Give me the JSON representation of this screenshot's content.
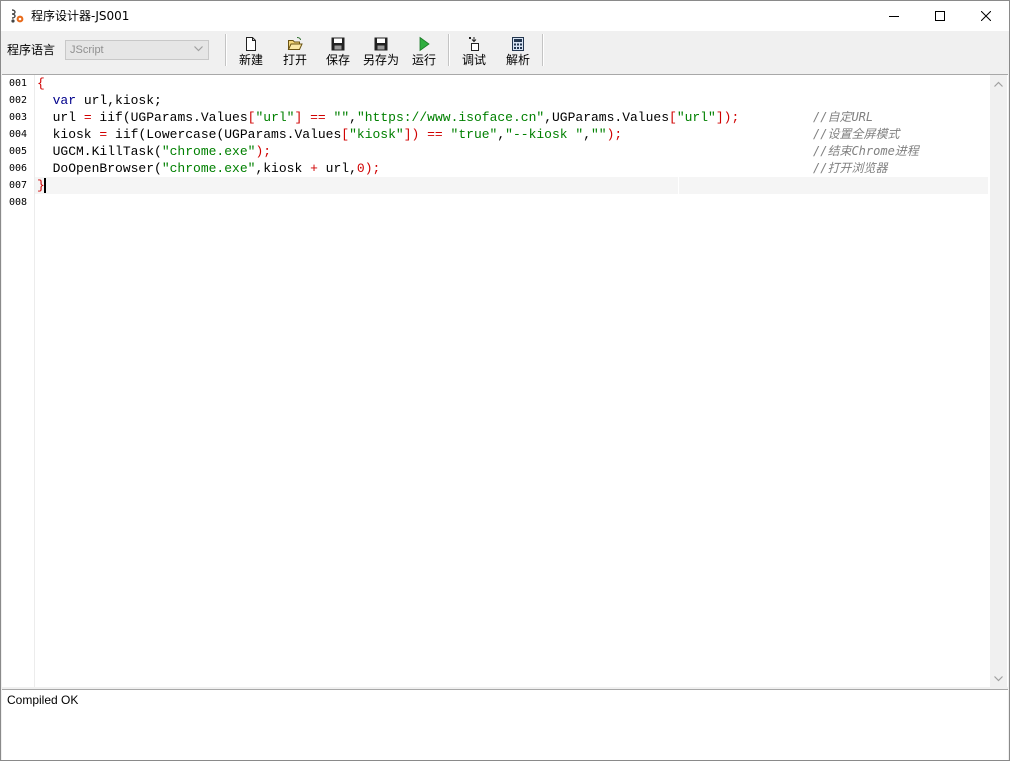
{
  "window": {
    "title": "程序设计器-JS001",
    "app_icon": "process-designer-icon",
    "controls": [
      "minimize-icon",
      "maximize-icon",
      "close-icon"
    ]
  },
  "toolbar": {
    "language_label": "程序语言",
    "language_value": "JScript",
    "buttons": [
      {
        "label": "新建",
        "icon": "new-file-icon"
      },
      {
        "label": "打开",
        "icon": "open-folder-icon"
      },
      {
        "label": "保存",
        "icon": "save-icon"
      },
      {
        "label": "另存为",
        "icon": "save-as-icon"
      },
      {
        "label": "运行",
        "icon": "run-icon"
      },
      {
        "label": "调试",
        "icon": "debug-icon"
      },
      {
        "label": "解析",
        "icon": "calculator-icon"
      }
    ]
  },
  "editor": {
    "line_numbers": [
      "001",
      "002",
      "003",
      "004",
      "005",
      "006",
      "007",
      "008"
    ],
    "current_line": 7,
    "lines": [
      [
        {
          "t": "{",
          "c": "op"
        }
      ],
      [
        {
          "t": "  ",
          "c": "id"
        },
        {
          "t": "var",
          "c": "kw"
        },
        {
          "t": " url,kiosk;",
          "c": "id"
        }
      ],
      [
        {
          "t": "  url ",
          "c": "id"
        },
        {
          "t": "=",
          "c": "op"
        },
        {
          "t": " iif(UGParams.Values",
          "c": "id"
        },
        {
          "t": "[",
          "c": "op"
        },
        {
          "t": "\"url\"",
          "c": "str"
        },
        {
          "t": "]",
          "c": "op"
        },
        {
          "t": " ",
          "c": "id"
        },
        {
          "t": "==",
          "c": "op"
        },
        {
          "t": " ",
          "c": "id"
        },
        {
          "t": "\"\"",
          "c": "str"
        },
        {
          "t": ",",
          "c": "id"
        },
        {
          "t": "\"https://www.isoface.cn\"",
          "c": "str"
        },
        {
          "t": ",UGParams.Values",
          "c": "id"
        },
        {
          "t": "[",
          "c": "op"
        },
        {
          "t": "\"url\"",
          "c": "str"
        },
        {
          "t": "]);",
          "c": "op"
        }
      ],
      [
        {
          "t": "  kiosk ",
          "c": "id"
        },
        {
          "t": "=",
          "c": "op"
        },
        {
          "t": " iif(Lowercase(UGParams.Values",
          "c": "id"
        },
        {
          "t": "[",
          "c": "op"
        },
        {
          "t": "\"kiosk\"",
          "c": "str"
        },
        {
          "t": "])",
          "c": "op"
        },
        {
          "t": " ",
          "c": "id"
        },
        {
          "t": "==",
          "c": "op"
        },
        {
          "t": " ",
          "c": "id"
        },
        {
          "t": "\"true\"",
          "c": "str"
        },
        {
          "t": ",",
          "c": "id"
        },
        {
          "t": "\"--kiosk \"",
          "c": "str"
        },
        {
          "t": ",",
          "c": "id"
        },
        {
          "t": "\"\"",
          "c": "str"
        },
        {
          "t": ");",
          "c": "op"
        }
      ],
      [
        {
          "t": "  UGCM.KillTask(",
          "c": "id"
        },
        {
          "t": "\"chrome.exe\"",
          "c": "str"
        },
        {
          "t": ");",
          "c": "op"
        }
      ],
      [
        {
          "t": "  DoOpenBrowser(",
          "c": "id"
        },
        {
          "t": "\"chrome.exe\"",
          "c": "str"
        },
        {
          "t": ",kiosk ",
          "c": "id"
        },
        {
          "t": "+",
          "c": "op"
        },
        {
          "t": " url,",
          "c": "id"
        },
        {
          "t": "0",
          "c": "op"
        },
        {
          "t": ");",
          "c": "op"
        }
      ],
      [
        {
          "t": "}",
          "c": "op"
        }
      ],
      []
    ],
    "comments": [
      {
        "line": 3,
        "text": "//自定URL"
      },
      {
        "line": 4,
        "text": "//设置全屏模式"
      },
      {
        "line": 5,
        "text": "//结束Chrome进程"
      },
      {
        "line": 6,
        "text": "//打开浏览器"
      }
    ]
  },
  "output": {
    "text": "Compiled OK"
  }
}
